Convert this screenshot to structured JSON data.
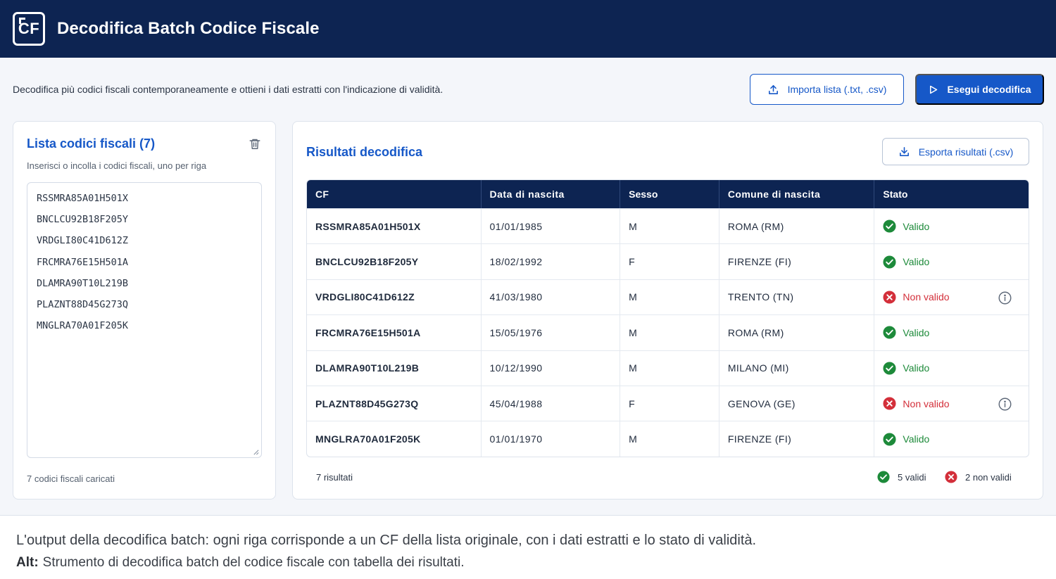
{
  "header": {
    "logo_text": "CF",
    "title": "Decodifica Batch Codice Fiscale"
  },
  "description": "Decodifica più codici fiscali contemporaneamente e ottieni i dati estratti con l'indicazione di validità.",
  "actions": {
    "import_label": "Importa lista (.txt, .csv)",
    "run_label": "Esegui decodifica"
  },
  "input_panel": {
    "title": "Lista codici fiscali (7)",
    "hint": "Inserisci o incolla i codici fiscali, uno per riga",
    "codes": [
      "RSSMRA85A01H501X",
      "BNCLCU92B18F205Y",
      "VRDGLI80C41D612Z",
      "FRCMRA76E15H501A",
      "DLAMRA90T10L219B",
      "PLAZNT88D45G273Q",
      "MNGLRA70A01F205K"
    ],
    "loaded_text": "7 codici fiscali caricati"
  },
  "results_panel": {
    "title": "Risultati decodifica",
    "export_label": "Esporta risultati (.csv)",
    "columns": [
      "CF",
      "Data di nascita",
      "Sesso",
      "Comune di nascita",
      "Stato"
    ],
    "rows": [
      {
        "cf": "RSSMRA85A01H501X",
        "date": "01/01/1985",
        "sex": "M",
        "city": "ROMA (RM)",
        "status": "Valido",
        "valid": true
      },
      {
        "cf": "BNCLCU92B18F205Y",
        "date": "18/02/1992",
        "sex": "F",
        "city": "FIRENZE (FI)",
        "status": "Valido",
        "valid": true
      },
      {
        "cf": "VRDGLI80C41D612Z",
        "date": "41/03/1980",
        "sex": "M",
        "city": "TRENTO (TN)",
        "status": "Non valido",
        "valid": false
      },
      {
        "cf": "FRCMRA76E15H501A",
        "date": "15/05/1976",
        "sex": "M",
        "city": "ROMA (RM)",
        "status": "Valido",
        "valid": true
      },
      {
        "cf": "DLAMRA90T10L219B",
        "date": "10/12/1990",
        "sex": "M",
        "city": "MILANO (MI)",
        "status": "Valido",
        "valid": true
      },
      {
        "cf": "PLAZNT88D45G273Q",
        "date": "45/04/1988",
        "sex": "F",
        "city": "GENOVA (GE)",
        "status": "Non valido",
        "valid": false
      },
      {
        "cf": "MNGLRA70A01F205K",
        "date": "01/01/1970",
        "sex": "M",
        "city": "FIRENZE (FI)",
        "status": "Valido",
        "valid": true
      }
    ],
    "results_count": "7 risultati",
    "valid_count": "5 validi",
    "invalid_count": "2 non validi"
  },
  "caption": {
    "text": "L'output della decodifica batch: ogni riga corrisponde a un CF della lista originale, con i dati estratti e lo stato di validità.",
    "alt_label": "Alt:",
    "alt_text": "Strumento di decodifica batch del codice fiscale con tabella dei risultati."
  },
  "colors": {
    "header_bg": "#0d2452",
    "accent": "#1658c8",
    "valid": "#1d8a3a",
    "invalid": "#d32f3a"
  },
  "icons": [
    "upload-icon",
    "play-icon",
    "trash-icon",
    "download-icon",
    "check-circle-icon",
    "x-circle-icon",
    "info-icon",
    "resize-handle-icon"
  ]
}
